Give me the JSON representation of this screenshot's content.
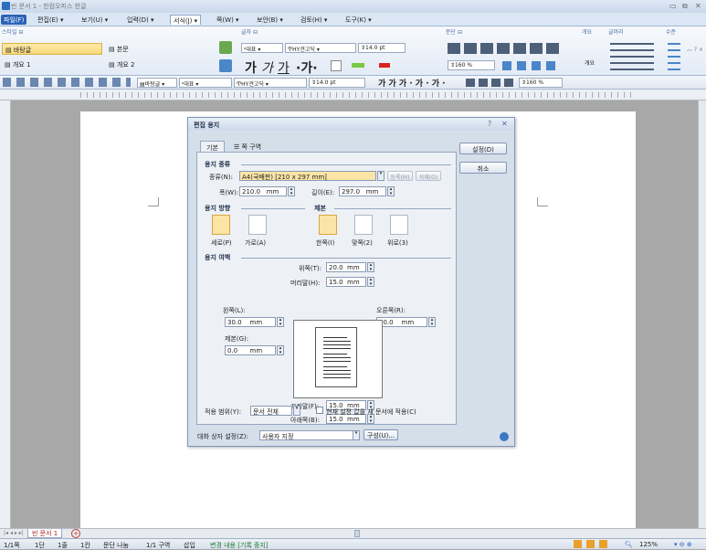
{
  "window": {
    "title": "빈 문서 1 - 한컴오피스 한글",
    "minimize": "▭",
    "restore": "⧉",
    "close": "✕"
  },
  "menu": [
    {
      "label": "파일(F)",
      "kind": "file"
    },
    {
      "label": "편집(E) ▾"
    },
    {
      "label": "보기(U) ▾"
    },
    {
      "label": "입력(D) ▾"
    },
    {
      "label": "서식(J) ▾",
      "kind": "active"
    },
    {
      "label": "쪽(W) ▾"
    },
    {
      "label": "보안(B) ▾"
    },
    {
      "label": "검토(H) ▾"
    },
    {
      "label": "도구(K) ▾"
    }
  ],
  "ribbon": {
    "groups": {
      "style": "스타일 ⊟",
      "font": "글자 ⊟",
      "para": "문단 ⊟",
      "outline": "개요",
      "bullets": "글머리",
      "level": "수준"
    },
    "styles": [
      {
        "label": "바탕글",
        "selected": true
      },
      {
        "label": "본문"
      },
      {
        "label": "개요 1"
      },
      {
        "label": "개요 2"
      }
    ],
    "font_lang": "대표",
    "font_name": "HY견고딕",
    "font_size": "14.0",
    "font_unit": "pt",
    "font_glyphs": [
      "가",
      "가",
      "가",
      "·가·"
    ],
    "line_spacing": "160",
    "line_unit": "%",
    "outline_label": "개요"
  },
  "toolbar2": {
    "style": "바탕글",
    "lang": "대표",
    "font": "HY견고딕",
    "size": "14.0",
    "unit": "pt",
    "spacing": "160",
    "spacing_unit": "%"
  },
  "dialog": {
    "title": "편집 용지",
    "help": "?",
    "close": "✕",
    "tabs": [
      {
        "label": "기본",
        "on": true
      },
      {
        "label": "☰ 쪽 구역",
        "on": false
      }
    ],
    "buttons": {
      "ok": "설정(D)",
      "cancel": "취소"
    },
    "paper": {
      "section": "용지 종류",
      "kind_label": "종류(N):",
      "kind_value": "A4(국배판) [210 x 297 mm]",
      "register": "등록(M)",
      "delete": "삭제(O)",
      "width_label": "폭(W):",
      "width_value": "210.0",
      "width_unit": "mm",
      "height_label": "길이(E):",
      "height_value": "297.0",
      "height_unit": "mm"
    },
    "orientation": {
      "section": "용지 방향",
      "portrait": "세로(P)",
      "landscape": "가로(A)"
    },
    "binding": {
      "section": "제본",
      "one": "한쪽(I)",
      "both": "맞쪽(2)",
      "top": "위로(3)"
    },
    "margins": {
      "section": "용지 여백",
      "top_label": "위쪽(T):",
      "top_value": "20.0",
      "header_label": "머리말(H):",
      "header_value": "15.0",
      "left_label": "왼쪽(L):",
      "left_value": "30.0",
      "right_label": "오른쪽(R):",
      "right_value": "30.0",
      "gutter_label": "제본(G):",
      "gutter_value": "0.0",
      "footer_label": "꼬리말(F):",
      "footer_value": "15.0",
      "bottom_label": "아래쪽(B):",
      "bottom_value": "15.0",
      "unit": "mm"
    },
    "apply_label": "적용 범위(Y):",
    "apply_value": "문서 전체",
    "apply_new": "현재 설정 값을 새 문서에 적용(C)",
    "settings_label": "대화 상자 설정(Z):",
    "settings_value": "사용자 지정",
    "compose": "구성(U)..."
  },
  "doctab": "빈 문서 1",
  "status": {
    "page": "1/1쪽",
    "section": "1단",
    "line": "1줄",
    "col": "1칸",
    "split": "문단 나눔",
    "area": "1/1 구역",
    "mode": "삽입",
    "track": "변경 내용 [기록 중지]",
    "zoom": "125%"
  },
  "colors": {
    "accent": "#2a63b6",
    "track": "#1f7a2e"
  }
}
